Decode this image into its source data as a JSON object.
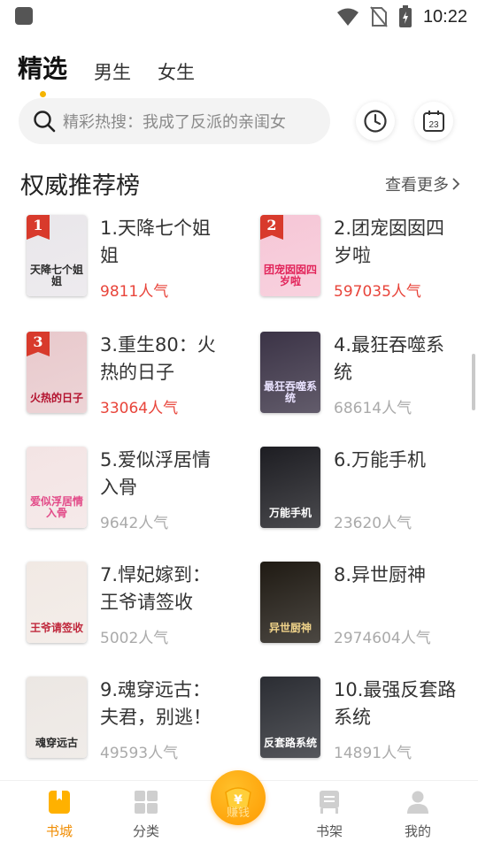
{
  "status_bar": {
    "time": "10:22",
    "icons": [
      "app-notification-icon",
      "wifi-icon",
      "no-sim-icon",
      "battery-charging-icon"
    ]
  },
  "top_tabs": [
    {
      "label": "精选",
      "active": true
    },
    {
      "label": "男生",
      "active": false
    },
    {
      "label": "女生",
      "active": false
    }
  ],
  "search": {
    "text": "精彩热搜：我成了反派的亲闺女",
    "icons": [
      "search-icon",
      "history-icon",
      "calendar-icon"
    ],
    "calendar_day": "23"
  },
  "section": {
    "title": "权威推荐榜",
    "more_label": "查看更多"
  },
  "books": [
    {
      "rank": "1",
      "name": "1.天降七个姐姐",
      "popularity": "9811人气",
      "hot": true,
      "cover_title": "天降七个姐姐",
      "cover_bg": "#e9e6ea",
      "cover_fg": "#2a2a2a"
    },
    {
      "rank": "2",
      "name": "2.团宠囡囡四岁啦",
      "popularity": "597035人气",
      "hot": true,
      "cover_title": "团宠囡囡四岁啦",
      "cover_bg": "#f6c6d6",
      "cover_fg": "#e2245a"
    },
    {
      "rank": "3",
      "name": "3.重生80：火热的日子",
      "popularity": "33064人气",
      "hot": true,
      "cover_title": "火热的日子",
      "cover_bg": "#e8c9cc",
      "cover_fg": "#b3122e"
    },
    {
      "rank": "",
      "name": "4.最狂吞噬系统",
      "popularity": "68614人气",
      "hot": false,
      "cover_title": "最狂吞噬系统",
      "cover_bg": "#3b3346",
      "cover_fg": "#e9e2ff"
    },
    {
      "rank": "",
      "name": "5.爱似浮居情入骨",
      "popularity": "9642人气",
      "hot": false,
      "cover_title": "爱似浮居情入骨",
      "cover_bg": "#f3e4e4",
      "cover_fg": "#e24a88"
    },
    {
      "rank": "",
      "name": "6.万能手机",
      "popularity": "23620人气",
      "hot": false,
      "cover_title": "万能手机",
      "cover_bg": "#1d1d22",
      "cover_fg": "#ffffff"
    },
    {
      "rank": "",
      "name": "7.悍妃嫁到：王爷请签收",
      "popularity": "5002人气",
      "hot": false,
      "cover_title": "王爷请签收",
      "cover_bg": "#f1e9e4",
      "cover_fg": "#c0283c"
    },
    {
      "rank": "",
      "name": "8.异世厨神",
      "popularity": "2974604人气",
      "hot": false,
      "cover_title": "异世厨神",
      "cover_bg": "#1f1a13",
      "cover_fg": "#f0d38a"
    },
    {
      "rank": "",
      "name": "9.魂穿远古：夫君，别逃！",
      "popularity": "49593人气",
      "hot": false,
      "cover_title": "魂穿远古",
      "cover_bg": "#ece7e3",
      "cover_fg": "#2a2a2a"
    },
    {
      "rank": "",
      "name": "10.最强反套路系统",
      "popularity": "14891人气",
      "hot": false,
      "cover_title": "反套路系统",
      "cover_bg": "#2b2d33",
      "cover_fg": "#ffffff"
    }
  ],
  "bottom_nav": [
    {
      "label": "书城",
      "icon": "bookstore-icon",
      "active": true
    },
    {
      "label": "分类",
      "icon": "category-grid-icon",
      "active": false
    },
    {
      "label": "赚钱",
      "icon": "yuan-coin-icon",
      "active": false
    },
    {
      "label": "书架",
      "icon": "bookshelf-icon",
      "active": false
    },
    {
      "label": "我的",
      "icon": "profile-icon",
      "active": false
    }
  ],
  "colors": {
    "accent": "#f5b400",
    "hot_red": "#e8443a",
    "nav_active": "#f08c00",
    "badge_red": "#d83a2c"
  }
}
